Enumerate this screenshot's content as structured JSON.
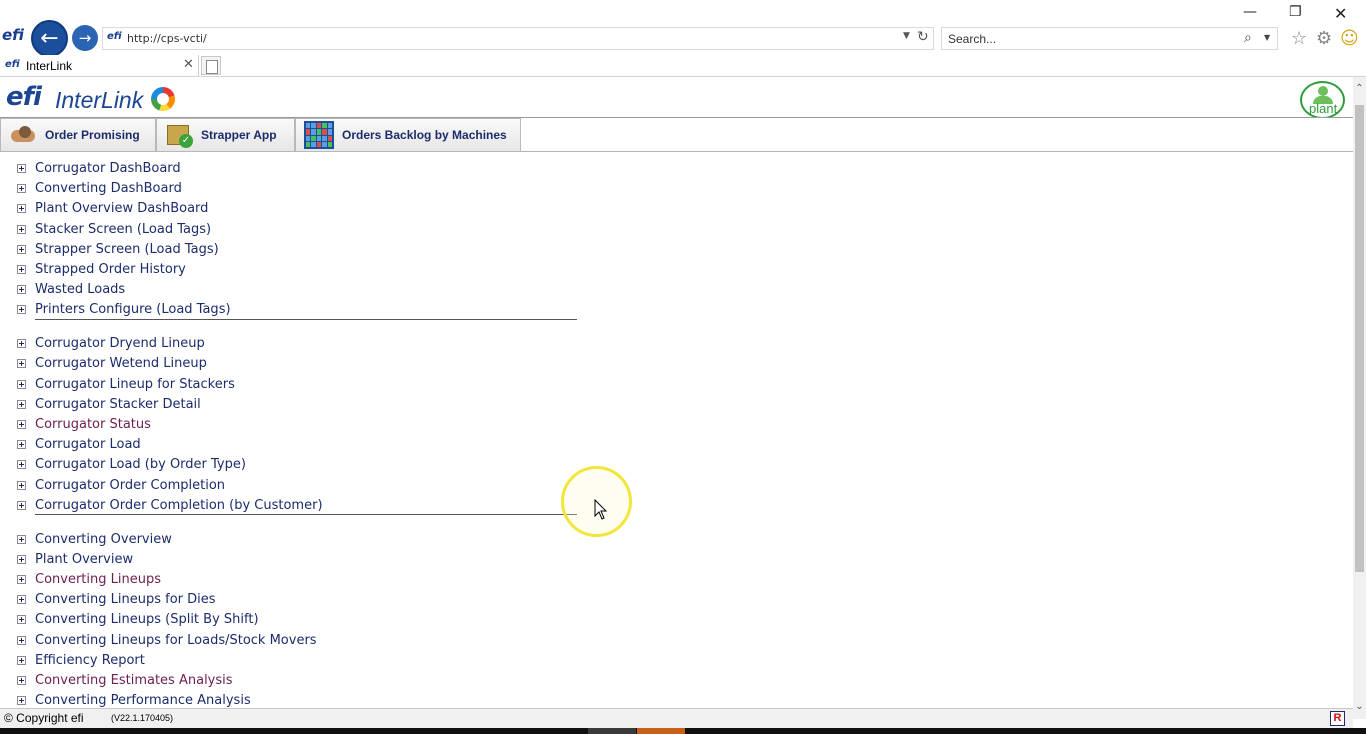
{
  "browser": {
    "favicon_text": "efi",
    "address": "http://cps-vcti/",
    "search_placeholder": "Search...",
    "tab_title": "InterLink"
  },
  "app": {
    "logo_text": "efi",
    "title": "InterLink",
    "plant_label": "plant"
  },
  "toolbar": [
    {
      "label": "Order Promising",
      "icon": "handshake-icon"
    },
    {
      "label": "Strapper App",
      "icon": "box-check-icon"
    },
    {
      "label": "Orders Backlog by Machines",
      "icon": "grid-board-icon"
    }
  ],
  "menu_groups": [
    {
      "items": [
        {
          "label": "Corrugator DashBoard",
          "visited": false
        },
        {
          "label": "Converting DashBoard",
          "visited": false
        },
        {
          "label": "Plant Overview DashBoard",
          "visited": false
        },
        {
          "label": "Stacker Screen (Load Tags)",
          "visited": false
        },
        {
          "label": "Strapper Screen (Load Tags)",
          "visited": false
        },
        {
          "label": "Strapped Order History",
          "visited": false
        },
        {
          "label": "Wasted Loads",
          "visited": false
        },
        {
          "label": "Printers Configure (Load Tags)",
          "visited": false
        }
      ]
    },
    {
      "items": [
        {
          "label": "Corrugator Dryend Lineup",
          "visited": false
        },
        {
          "label": "Corrugator Wetend Lineup",
          "visited": false
        },
        {
          "label": "Corrugator Lineup for Stackers",
          "visited": false
        },
        {
          "label": "Corrugator Stacker Detail",
          "visited": false
        },
        {
          "label": "Corrugator Status",
          "visited": true
        },
        {
          "label": "Corrugator Load",
          "visited": false
        },
        {
          "label": "Corrugator Load (by Order Type)",
          "visited": false
        },
        {
          "label": "Corrugator Order Completion",
          "visited": false
        },
        {
          "label": "Corrugator Order Completion (by Customer)",
          "visited": false
        }
      ]
    },
    {
      "items": [
        {
          "label": "Converting Overview",
          "visited": false
        },
        {
          "label": "Plant Overview",
          "visited": false
        },
        {
          "label": "Converting Lineups",
          "visited": true
        },
        {
          "label": "Converting Lineups for Dies",
          "visited": false
        },
        {
          "label": "Converting Lineups (Split By Shift)",
          "visited": false
        },
        {
          "label": "Converting Lineups for Loads/Stock Movers",
          "visited": false
        },
        {
          "label": "Efficiency Report",
          "visited": false
        },
        {
          "label": "Converting Estimates Analysis",
          "visited": true
        },
        {
          "label": "Converting Performance Analysis",
          "visited": false
        }
      ]
    }
  ],
  "footer": {
    "copyright": "© Copyright efi",
    "version": "(V22.1.170405)",
    "r_badge": "R"
  },
  "colors": {
    "link": "#1c2c6b",
    "visited_link": "#6b1f4f",
    "brand_blue": "#1c4594",
    "plant_green": "#2e9c3a"
  }
}
